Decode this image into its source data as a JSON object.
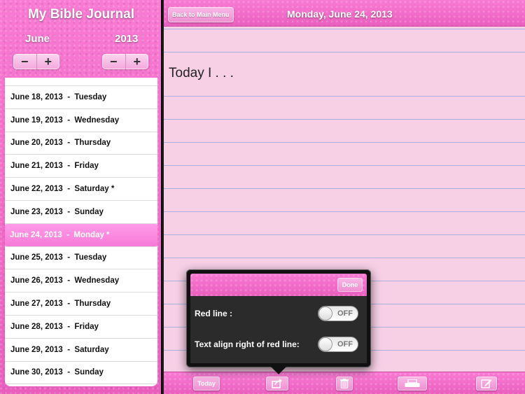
{
  "sidebar": {
    "title": "My Bible Journal",
    "month": "June",
    "year": "2013",
    "minus": "−",
    "plus": "+",
    "days": [
      {
        "label": "June 18, 2013  -  Tuesday"
      },
      {
        "label": "June 19, 2013  -  Wednesday"
      },
      {
        "label": "June 20, 2013  -  Thursday"
      },
      {
        "label": "June 21, 2013  -  Friday"
      },
      {
        "label": "June 22, 2013  -  Saturday *"
      },
      {
        "label": "June 23, 2013  -  Sunday"
      },
      {
        "label": "June 24, 2013  -  Monday *",
        "selected": true
      },
      {
        "label": "June 25, 2013  -  Tuesday"
      },
      {
        "label": "June 26, 2013  -  Wednesday"
      },
      {
        "label": "June 27, 2013  -  Thursday"
      },
      {
        "label": "June 28, 2013  -  Friday"
      },
      {
        "label": "June 29, 2013  -  Saturday"
      },
      {
        "label": "June 30, 2013  -  Sunday"
      }
    ]
  },
  "header": {
    "back_label": "Back to Main Menu",
    "date_title": "Monday, June 24, 2013"
  },
  "journal": {
    "entry_text": "Today I . . ."
  },
  "popover": {
    "done_label": "Done",
    "options": [
      {
        "label": "Red line :",
        "state": "OFF"
      },
      {
        "label": "Text align right of red line:",
        "state": "OFF"
      }
    ]
  },
  "toolbar": {
    "today_label": "Today",
    "icons": [
      "share-icon",
      "trash-icon",
      "print-icon",
      "compose-icon"
    ]
  },
  "colors": {
    "accent_pink": "#f36fc7",
    "paper": "#f7d0e6",
    "rule_line": "#a9b1dc",
    "selected_row": "#f77ad8"
  }
}
